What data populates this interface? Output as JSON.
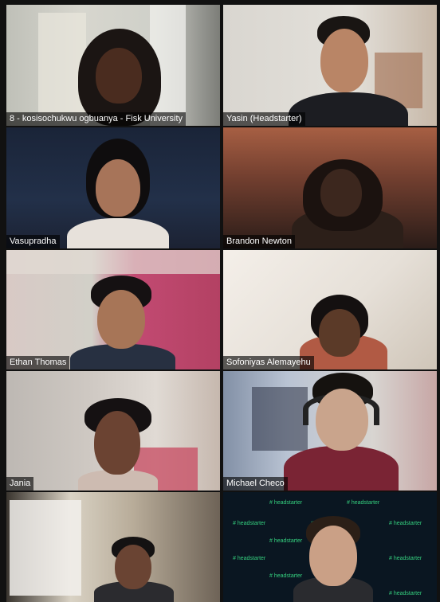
{
  "participants": [
    {
      "name": "8 - kosisochukwu ogbuanya - Fisk University"
    },
    {
      "name": "Yasin (Headstarter)"
    },
    {
      "name": "Vasupradha"
    },
    {
      "name": "Brandon Newton"
    },
    {
      "name": "Ethan Thomas"
    },
    {
      "name": "Sofoniyas Alemayehu"
    },
    {
      "name": "Jania"
    },
    {
      "name": "Michael Checo"
    }
  ],
  "background_watermark": "# headstarter"
}
